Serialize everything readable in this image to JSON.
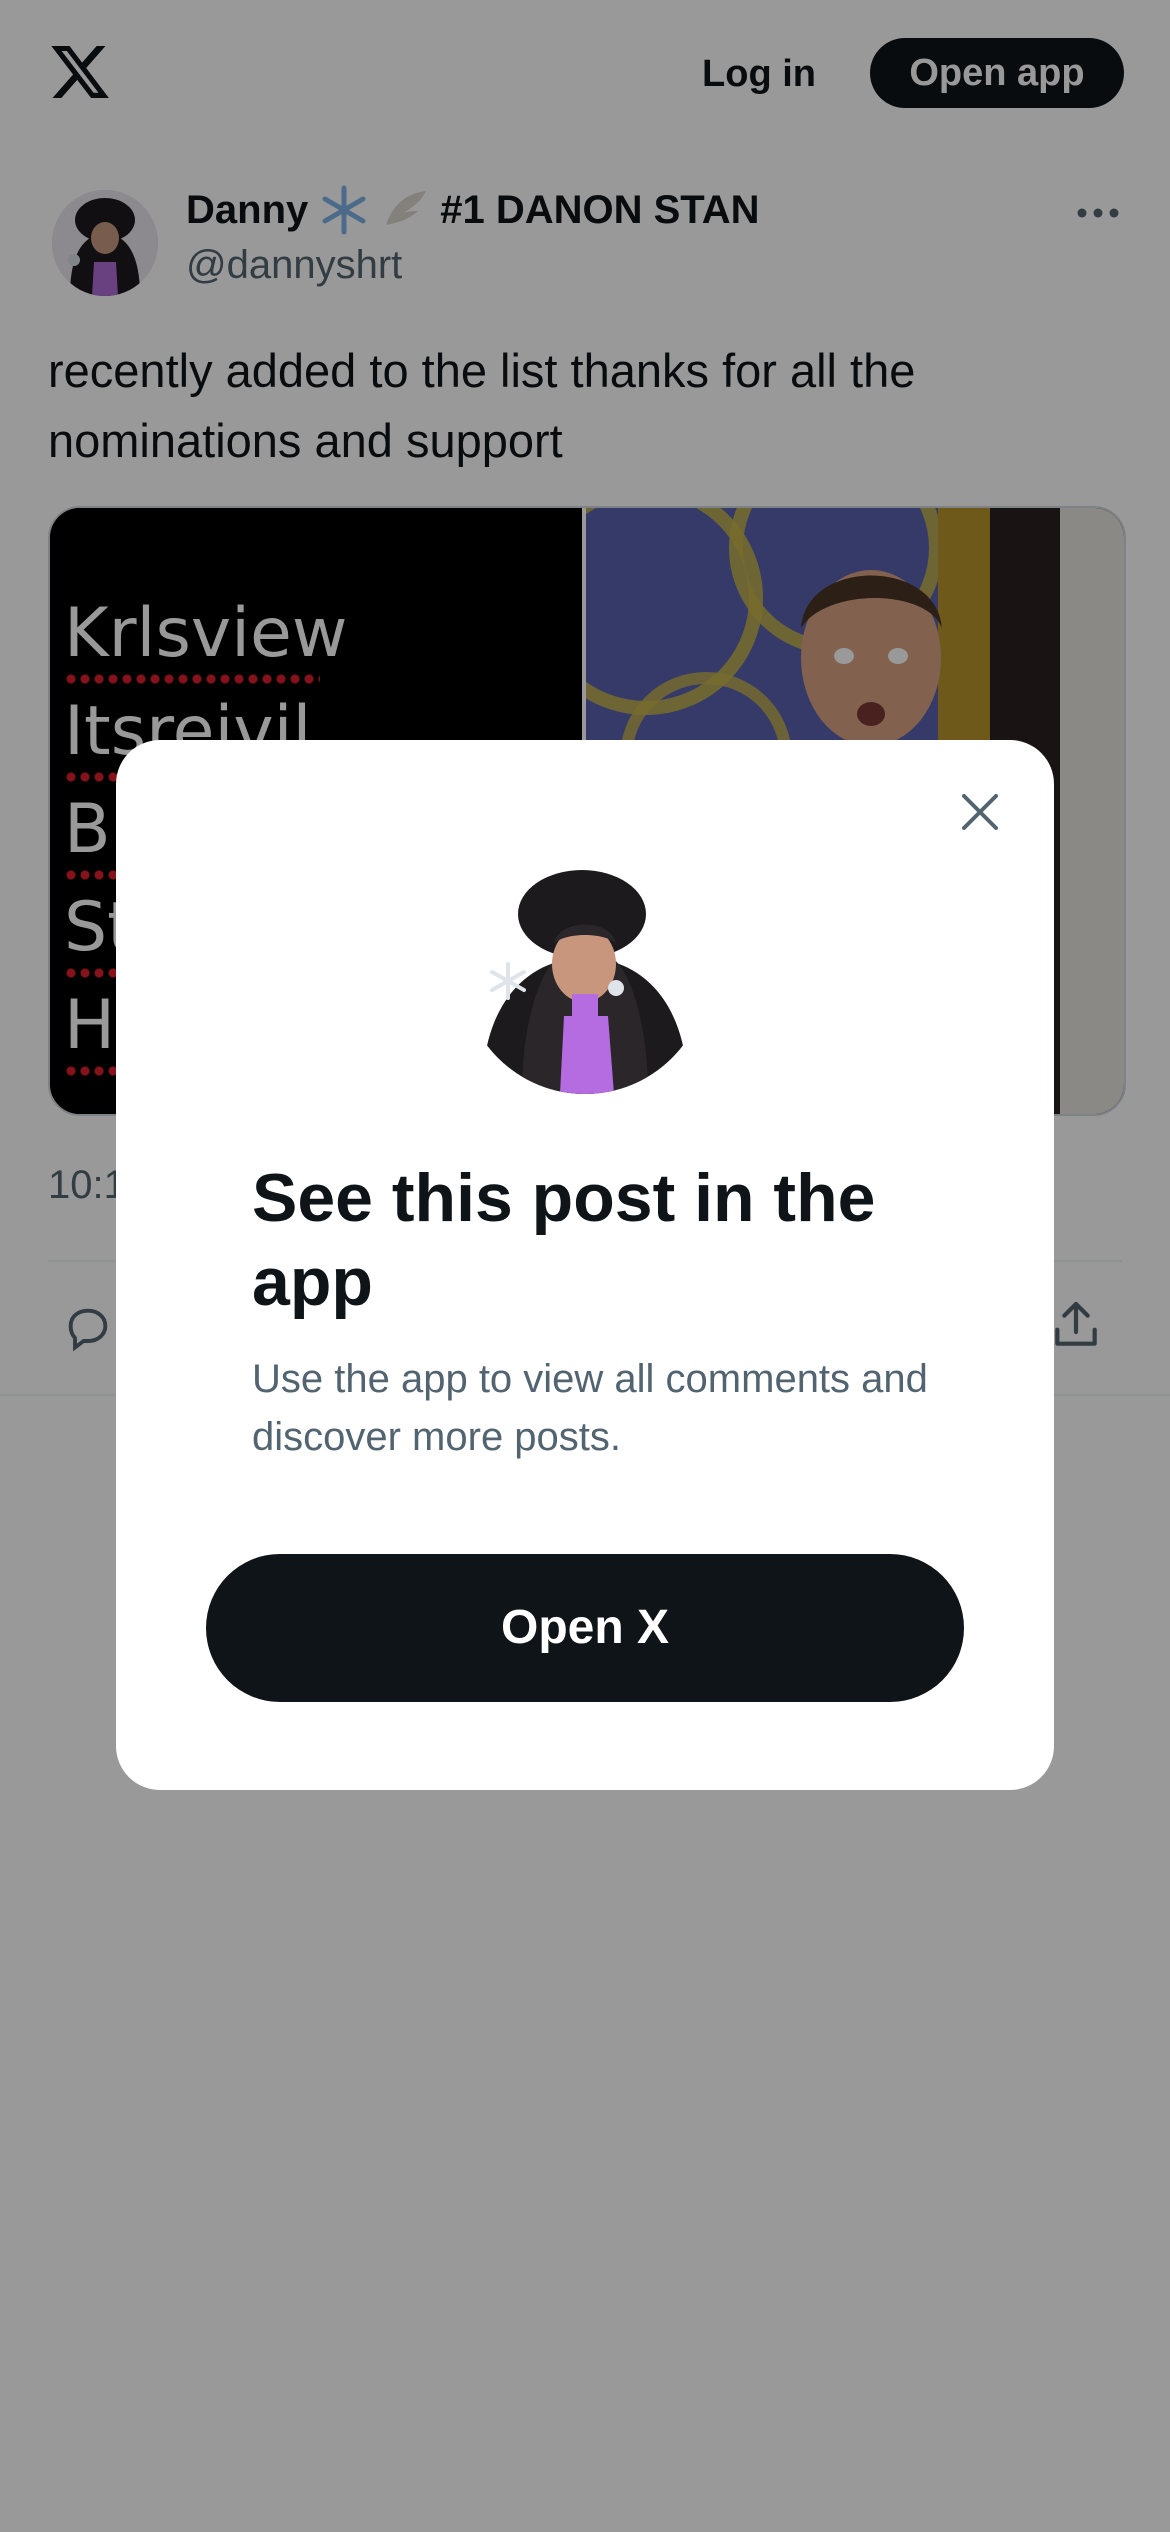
{
  "header": {
    "logo_icon": "x-logo-icon",
    "login_label": "Log in",
    "open_app_label": "Open app"
  },
  "post": {
    "author_name": "Danny",
    "author_name_emojis": [
      "snowflake-emoji",
      "wing-emoji"
    ],
    "author_name_suffix": "#1 DANON STAN",
    "author_handle": "@dannyshrt",
    "text": "recently added to the list thanks for all the nominations and support",
    "media_list_lines": [
      "Krlsview",
      "Itsreivil",
      "Br",
      "St",
      "H"
    ],
    "timestamp": "10:1"
  },
  "modal": {
    "title": "See this post in the app",
    "subtitle": "Use the app to view all comments and discover more posts.",
    "cta_label": "Open X",
    "close_icon": "close-icon"
  },
  "colors": {
    "text_primary": "#0f1419",
    "text_secondary": "#536471",
    "button_dark": "#0f1419",
    "scrim": "rgba(0,0,0,0.4)"
  }
}
